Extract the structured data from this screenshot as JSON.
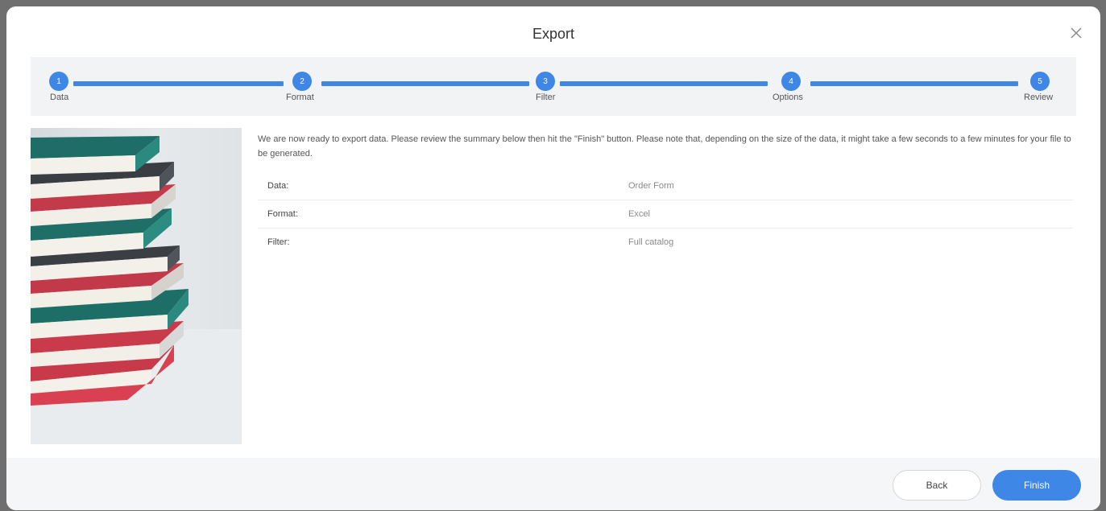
{
  "dialog": {
    "title": "Export",
    "close_icon": "close-icon"
  },
  "stepper": {
    "steps": [
      {
        "number": "1",
        "label": "Data"
      },
      {
        "number": "2",
        "label": "Format"
      },
      {
        "number": "3",
        "label": "Filter"
      },
      {
        "number": "4",
        "label": "Options"
      },
      {
        "number": "5",
        "label": "Review"
      }
    ]
  },
  "content": {
    "intro": "We are now ready to export data. Please review the summary below then hit the \"Finish\" button. Please note that, depending on the size of the data, it might take a few seconds to a few minutes for your file to be generated.",
    "summary": [
      {
        "key": "Data:",
        "value": "Order Form"
      },
      {
        "key": "Format:",
        "value": "Excel"
      },
      {
        "key": "Filter:",
        "value": "Full catalog"
      }
    ]
  },
  "footer": {
    "back_label": "Back",
    "finish_label": "Finish"
  },
  "colors": {
    "accent": "#3f87e6",
    "stepper_bg": "#f2f3f5",
    "footer_bg": "#f5f6f8"
  }
}
